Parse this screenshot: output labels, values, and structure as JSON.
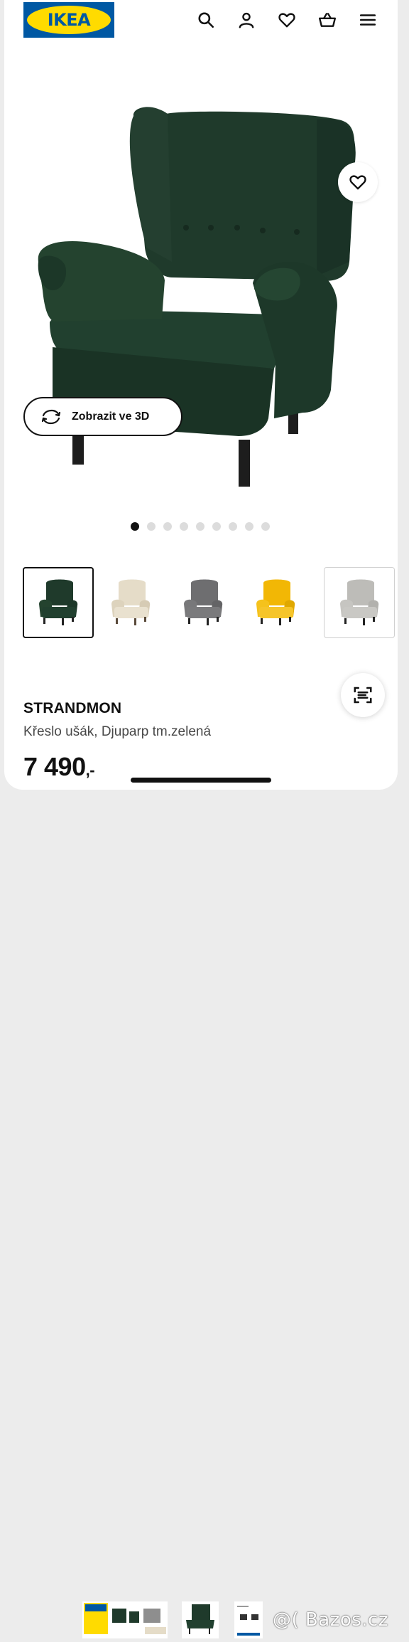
{
  "header": {
    "logo_text": "IKEA",
    "icons": [
      "search-icon",
      "account-icon",
      "heart-icon",
      "basket-icon",
      "menu-icon"
    ]
  },
  "hero": {
    "view_3d_label": "Zobrazit ve 3D",
    "carousel_count": 9,
    "carousel_active": 1
  },
  "variants": [
    {
      "color": "#1f3a2b",
      "selected": true
    },
    {
      "color": "#e5dcc8",
      "selected": false
    },
    {
      "color": "#6e6e70",
      "selected": false
    },
    {
      "color": "#f2b705",
      "selected": false
    },
    {
      "color": "#bdbcb8",
      "selected": false
    }
  ],
  "product": {
    "name": "STRANDMON",
    "description": "Křeslo ušák, Djuparp tm.zelená",
    "price": "7 490",
    "price_suffix": ",-"
  },
  "watermark": "@( Bazos.cz",
  "colors": {
    "brand_blue": "#0058a3",
    "brand_yellow": "#ffdb00",
    "chair_green": "#1f3a2b"
  }
}
